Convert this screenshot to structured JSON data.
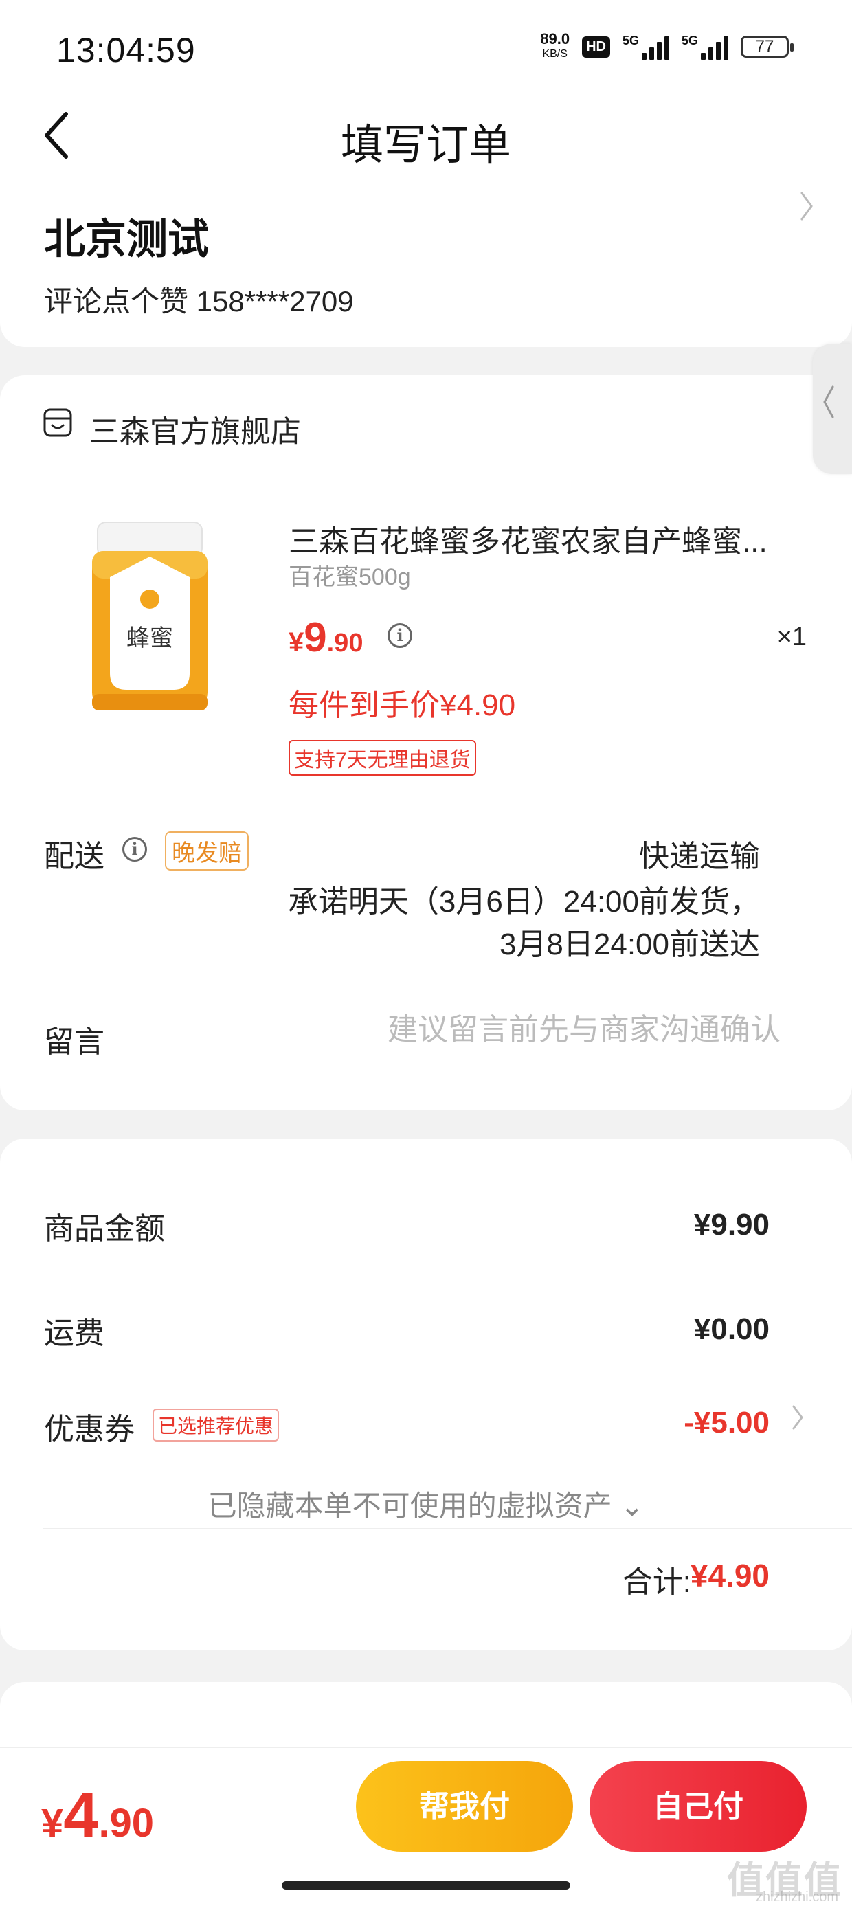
{
  "status_bar": {
    "time": "13:04:59",
    "net_speed": "89.0",
    "net_unit": "KB/S",
    "hd": "HD",
    "signal1": "5G",
    "signal2": "5G",
    "battery": "77"
  },
  "header": {
    "title": "填写订单",
    "back_icon": "chevron-left-icon"
  },
  "address": {
    "name": "北京测试",
    "contact": "评论点个赞  158****2709"
  },
  "store": {
    "name": "三森官方旗舰店",
    "icon": "store-icon"
  },
  "product": {
    "title": "三森百花蜂蜜多花蜜农家自产蜂蜜...",
    "spec": "百花蜜500g",
    "price_currency": "¥",
    "price_int": "9",
    "price_dec": ".90",
    "qty": "×1",
    "final_price": "每件到手价¥4.90",
    "return_policy": "支持7天无理由退货",
    "image_label": "蜂蜜"
  },
  "delivery": {
    "label": "配送",
    "late_badge": "晚发赔",
    "method": "快递运输",
    "promise_line1": "承诺明天（3月6日）24:00前发货，",
    "promise_line2": "3月8日24:00前送达"
  },
  "message": {
    "label": "留言",
    "placeholder": "建议留言前先与商家沟通确认"
  },
  "amounts": {
    "goods_label": "商品金额",
    "goods_value": "¥9.90",
    "shipping_label": "运费",
    "shipping_value": "¥0.00",
    "coupon_label": "优惠券",
    "coupon_badge": "已选推荐优惠",
    "coupon_value": "-¥5.00",
    "hidden_assets": "已隐藏本单不可使用的虚拟资产 ⌄",
    "total_label": "合计:",
    "total_value": "¥4.90"
  },
  "bottom": {
    "price_currency": "¥",
    "price_int": "4",
    "price_dec": ".90",
    "help_pay": "帮我付",
    "self_pay": "自己付"
  },
  "watermark": {
    "text": "值值值",
    "sub": "zhizhizhi.com"
  },
  "colors": {
    "accent_red": "#e8362c",
    "help_button": "#fcc21b",
    "self_button": "#e9222f"
  }
}
